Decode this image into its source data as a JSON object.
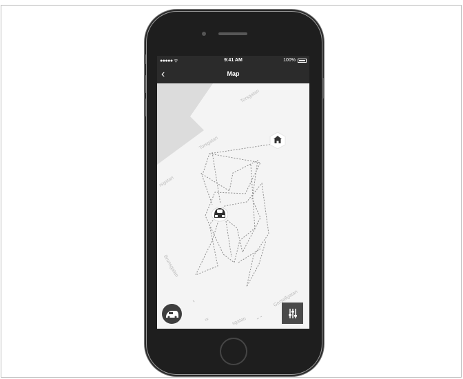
{
  "status_bar": {
    "signal": "●●●●● ᯤ",
    "time": "9:41 AM",
    "battery_percent": "100%"
  },
  "nav": {
    "back_icon": "chevron-left-icon",
    "back_glyph": "‹",
    "title": "Map"
  },
  "map": {
    "streets": [
      "Torsgatan",
      "Torsgatan",
      "rsgatan",
      "Brunsgatan",
      "Gersallgatan",
      "sgatan",
      "lt"
    ]
  },
  "controls": {
    "mower_icon": "mower-icon",
    "settings_icon": "sliders-icon",
    "home_marker_icon": "home-icon"
  },
  "colors": {
    "screen_bg": "#f4f4f4",
    "navbar_bg": "#2b2b2b",
    "map_area": "#dcdcdc",
    "path": "#8c8c8c"
  }
}
